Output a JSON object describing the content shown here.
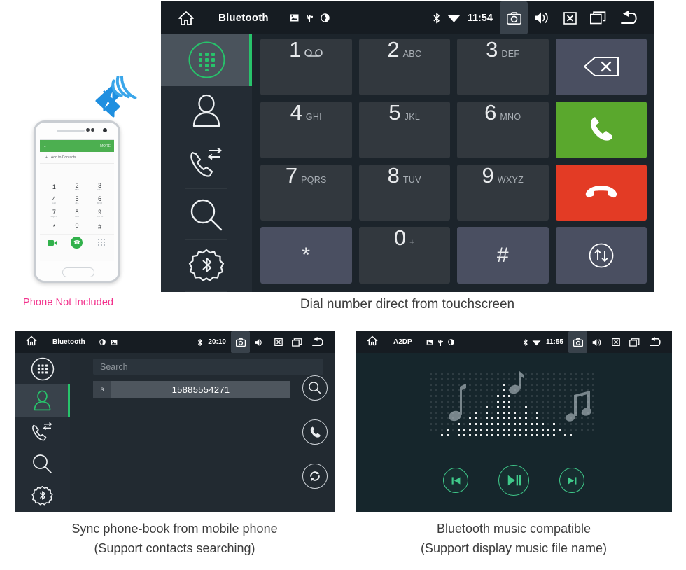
{
  "phone_illustration": {
    "bluetooth_icon": "bluetooth-wireless-icon",
    "app_back_label": "←",
    "app_more_label": "MORE",
    "add_to_contacts_label": "Add to Contacts",
    "add_icon": "plus-icon",
    "keys": [
      {
        "digit": "1",
        "sub": ""
      },
      {
        "digit": "2",
        "sub": "ABC"
      },
      {
        "digit": "3",
        "sub": "DEF"
      },
      {
        "digit": "4",
        "sub": "GHI"
      },
      {
        "digit": "5",
        "sub": "JKL"
      },
      {
        "digit": "6",
        "sub": "MNO"
      },
      {
        "digit": "7",
        "sub": "PQRS"
      },
      {
        "digit": "8",
        "sub": "TUV"
      },
      {
        "digit": "9",
        "sub": "WXYZ"
      },
      {
        "digit": "*",
        "sub": ""
      },
      {
        "digit": "0",
        "sub": "+"
      },
      {
        "digit": "#",
        "sub": ""
      }
    ],
    "not_included_text": "Phone Not Included",
    "not_included_color": "#f2328c"
  },
  "head_unit": {
    "statusbar": {
      "home_icon": "home-icon",
      "title": "Bluetooth",
      "small_icons": [
        "picture-icon",
        "usb-icon",
        "disc-icon"
      ],
      "bluetooth_icon": "bluetooth-icon",
      "wifi_icon": "wifi-icon",
      "clock": "11:54",
      "buttons": [
        {
          "icon": "camera-icon",
          "highlighted": true
        },
        {
          "icon": "volume-icon",
          "highlighted": false
        },
        {
          "icon": "close-box-icon",
          "highlighted": false
        },
        {
          "icon": "recents-icon",
          "highlighted": false
        },
        {
          "icon": "back-arrow-icon",
          "highlighted": false
        }
      ]
    },
    "rail": [
      {
        "name": "dialpad",
        "icon": "dialpad-grid-icon",
        "active": true
      },
      {
        "name": "contacts",
        "icon": "person-icon",
        "active": false
      },
      {
        "name": "call-history",
        "icon": "call-transfer-icon",
        "active": false
      },
      {
        "name": "search",
        "icon": "magnifier-icon",
        "active": false
      },
      {
        "name": "bluetooth-settings",
        "icon": "bluetooth-gear-icon",
        "active": false
      }
    ],
    "dialpad": [
      {
        "digit": "1",
        "sub": "",
        "style": "dark",
        "icon": "voicemail-icon"
      },
      {
        "digit": "2",
        "sub": "ABC",
        "style": "dark",
        "icon": ""
      },
      {
        "digit": "3",
        "sub": "DEF",
        "style": "dark",
        "icon": ""
      },
      {
        "digit": "",
        "sub": "",
        "style": "lilac",
        "icon": "backspace-icon"
      },
      {
        "digit": "4",
        "sub": "GHI",
        "style": "dark",
        "icon": ""
      },
      {
        "digit": "5",
        "sub": "JKL",
        "style": "dark",
        "icon": ""
      },
      {
        "digit": "6",
        "sub": "MNO",
        "style": "dark",
        "icon": ""
      },
      {
        "digit": "",
        "sub": "",
        "style": "green",
        "icon": "call-answer-icon"
      },
      {
        "digit": "7",
        "sub": "PQRS",
        "style": "dark",
        "icon": ""
      },
      {
        "digit": "8",
        "sub": "TUV",
        "style": "dark",
        "icon": ""
      },
      {
        "digit": "9",
        "sub": "WXYZ",
        "style": "dark",
        "icon": ""
      },
      {
        "digit": "",
        "sub": "",
        "style": "red",
        "icon": "call-end-icon"
      },
      {
        "digit": "*",
        "sub": "",
        "style": "lilac",
        "icon": ""
      },
      {
        "digit": "0",
        "sub": "+",
        "style": "dark",
        "icon": ""
      },
      {
        "digit": "#",
        "sub": "",
        "style": "lilac",
        "icon": ""
      },
      {
        "digit": "",
        "sub": "",
        "style": "lilac",
        "icon": "transfer-audio-icon"
      }
    ],
    "caption": "Dial number direct from touchscreen",
    "colors": {
      "answer_green": "#5aa82d",
      "end_red": "#e33b25",
      "accent": "#27c36b"
    }
  },
  "phonebook_panel": {
    "statusbar": {
      "home_icon": "home-icon",
      "title": "Bluetooth",
      "small_icons": [
        "disc-icon",
        "picture-icon"
      ],
      "bluetooth_icon": "bluetooth-icon",
      "clock": "20:10",
      "buttons": [
        {
          "icon": "camera-icon",
          "highlighted": true
        },
        {
          "icon": "volume-icon",
          "highlighted": false
        },
        {
          "icon": "close-box-icon",
          "highlighted": false
        },
        {
          "icon": "recents-icon",
          "highlighted": false
        },
        {
          "icon": "back-arrow-icon",
          "highlighted": false
        }
      ]
    },
    "rail": [
      {
        "name": "dialpad",
        "icon": "dialpad-grid-icon",
        "active": false
      },
      {
        "name": "contacts",
        "icon": "person-icon",
        "active": true
      },
      {
        "name": "call-history",
        "icon": "call-transfer-icon",
        "active": false
      },
      {
        "name": "search",
        "icon": "magnifier-icon",
        "active": false
      },
      {
        "name": "bluetooth-settings",
        "icon": "bluetooth-gear-icon",
        "active": false
      }
    ],
    "search_placeholder": "Search",
    "contacts": [
      {
        "initial": "s",
        "number": "15885554271"
      }
    ],
    "side_buttons": [
      {
        "name": "search-contacts",
        "icon": "magnifier-icon"
      },
      {
        "name": "call-contact",
        "icon": "phone-handset-icon"
      },
      {
        "name": "sync-contacts",
        "icon": "refresh-sync-icon"
      }
    ],
    "caption_line1": "Sync phone-book from mobile phone",
    "caption_line2": "(Support contacts searching)"
  },
  "music_panel": {
    "statusbar": {
      "home_icon": "home-icon",
      "title": "A2DP",
      "small_icons": [
        "picture-icon",
        "usb-icon",
        "disc-icon"
      ],
      "bluetooth_icon": "bluetooth-icon",
      "wifi_icon": "wifi-icon",
      "clock": "11:55",
      "buttons": [
        {
          "icon": "camera-icon",
          "highlighted": true
        },
        {
          "icon": "volume-icon",
          "highlighted": false
        },
        {
          "icon": "close-box-icon",
          "highlighted": false
        },
        {
          "icon": "recents-icon",
          "highlighted": false
        },
        {
          "icon": "back-arrow-icon",
          "highlighted": false
        }
      ]
    },
    "visualizer_icon": "music-equalizer-notes-graphic",
    "controls": [
      {
        "name": "previous-track",
        "icon": "skip-previous-icon"
      },
      {
        "name": "play-pause",
        "icon": "play-pause-icon"
      },
      {
        "name": "next-track",
        "icon": "skip-next-icon"
      }
    ],
    "caption_line1": "Bluetooth music compatible",
    "caption_line2": "(Support display music file name)",
    "accent_color": "#3fc98a"
  }
}
